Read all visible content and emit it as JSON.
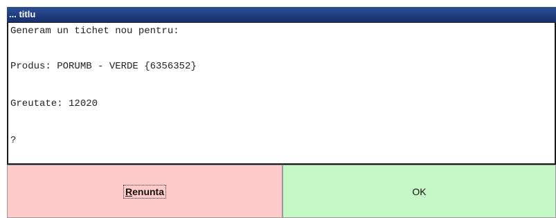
{
  "window": {
    "title": "... titlu"
  },
  "message": {
    "line1": "Generam un tichet nou pentru:",
    "line2": "Produs: PORUMB - VERDE {6356352}",
    "line3": "Greutate: 12020",
    "line4": "?"
  },
  "buttons": {
    "cancel_label": "Renunta",
    "ok_label": "OK"
  },
  "colors": {
    "titlebar": "#1f3b7d",
    "cancel_bg": "#ffcaca",
    "ok_bg": "#c6f7c6"
  }
}
